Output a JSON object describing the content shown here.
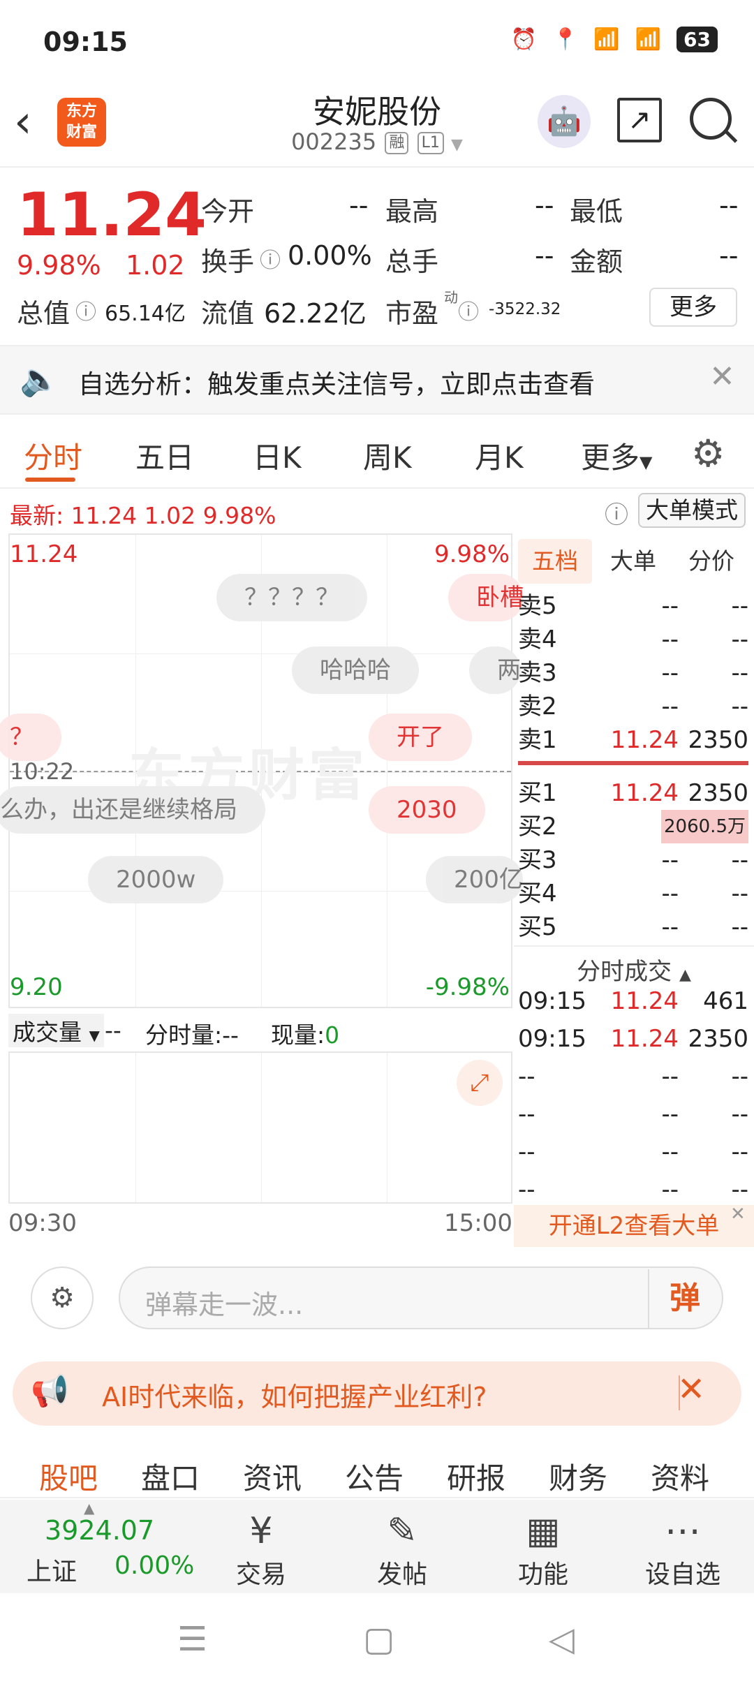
{
  "status_bar": {
    "time": "09:15",
    "network": "5G",
    "battery": "63"
  },
  "header": {
    "logo_line1": "东方",
    "logo_line2": "财富",
    "title": "安妮股份",
    "code": "002235",
    "tag_rong": "融",
    "tag_level": "L1"
  },
  "quote": {
    "price": "11.24",
    "change_pct": "9.98%",
    "change": "1.02",
    "labels": {
      "open": "今开",
      "high": "最高",
      "low": "最低",
      "turnover": "换手",
      "volume": "总手",
      "amount": "金额",
      "mktcap": "总值",
      "float_cap": "流值",
      "pe": "市盈",
      "pe_sup": "动"
    },
    "values": {
      "open": "--",
      "high": "--",
      "low": "--",
      "turnover": "0.00%",
      "volume": "--",
      "amount": "--",
      "mktcap": "65.14亿",
      "float_cap": "62.22亿",
      "pe": "-3522.32"
    },
    "more_label": "更多"
  },
  "banner": {
    "text": "自选分析：触发重点关注信号，立即点击查看"
  },
  "tabs": [
    "分时",
    "五日",
    "日K",
    "周K",
    "月K",
    "更多"
  ],
  "latest": {
    "label": "最新:",
    "price": "11.24",
    "change": "1.02",
    "pct": "9.98%"
  },
  "big_order_mode": "大单模式",
  "chart": {
    "top_price": "11.24",
    "top_pct": "9.98%",
    "bottom_price": "9.20",
    "bottom_pct": "-9.98%",
    "mid_time": "10:22",
    "watermark": "东方财富",
    "start_time": "09:30",
    "end_time": "15:00",
    "danmu": [
      "？？？？",
      "卧槽",
      "哈哈哈",
      "两",
      "？",
      "开了",
      "么办，出还是继续格局",
      "2030",
      "2000w",
      "200亿"
    ]
  },
  "volume_bar": {
    "label": "成交量",
    "val": "--",
    "fs_label": "分时量:",
    "fs_val": "--",
    "xl_label": "现量:",
    "xl_val": "0"
  },
  "order_book": {
    "tabs": [
      "五档",
      "大单",
      "分价"
    ],
    "asks": [
      {
        "label": "卖5",
        "price": "--",
        "vol": "--"
      },
      {
        "label": "卖4",
        "price": "--",
        "vol": "--"
      },
      {
        "label": "卖3",
        "price": "--",
        "vol": "--"
      },
      {
        "label": "卖2",
        "price": "--",
        "vol": "--"
      },
      {
        "label": "卖1",
        "price": "11.24",
        "vol": "2350"
      }
    ],
    "bids": [
      {
        "label": "买1",
        "price": "11.24",
        "vol": "2350"
      },
      {
        "label": "买2",
        "price": "--",
        "vol": "2060.5万"
      },
      {
        "label": "买3",
        "price": "--",
        "vol": "--"
      },
      {
        "label": "买4",
        "price": "--",
        "vol": "--"
      },
      {
        "label": "买5",
        "price": "--",
        "vol": "--"
      }
    ],
    "trades_title": "分时成交",
    "trades": [
      {
        "time": "09:15",
        "price": "11.24",
        "vol": "461"
      },
      {
        "time": "09:15",
        "price": "11.24",
        "vol": "2350"
      },
      {
        "time": "--",
        "price": "--",
        "vol": "--"
      },
      {
        "time": "--",
        "price": "--",
        "vol": "--"
      },
      {
        "time": "--",
        "price": "--",
        "vol": "--"
      },
      {
        "time": "--",
        "price": "--",
        "vol": "--"
      }
    ],
    "l2_cta": "开通L2查看大单"
  },
  "danmu_input": {
    "placeholder": "弹幕走一波...",
    "send_label": "弹"
  },
  "ad": {
    "text": "AI时代来临，如何把握产业红利?"
  },
  "bottom_tabs": [
    "股吧",
    "盘口",
    "资讯",
    "公告",
    "研报",
    "财务",
    "资料"
  ],
  "index": {
    "value": "3924.07",
    "name": "上证",
    "pct": "0.00%"
  },
  "bottom_nav": [
    "交易",
    "发帖",
    "功能",
    "设自选"
  ]
}
